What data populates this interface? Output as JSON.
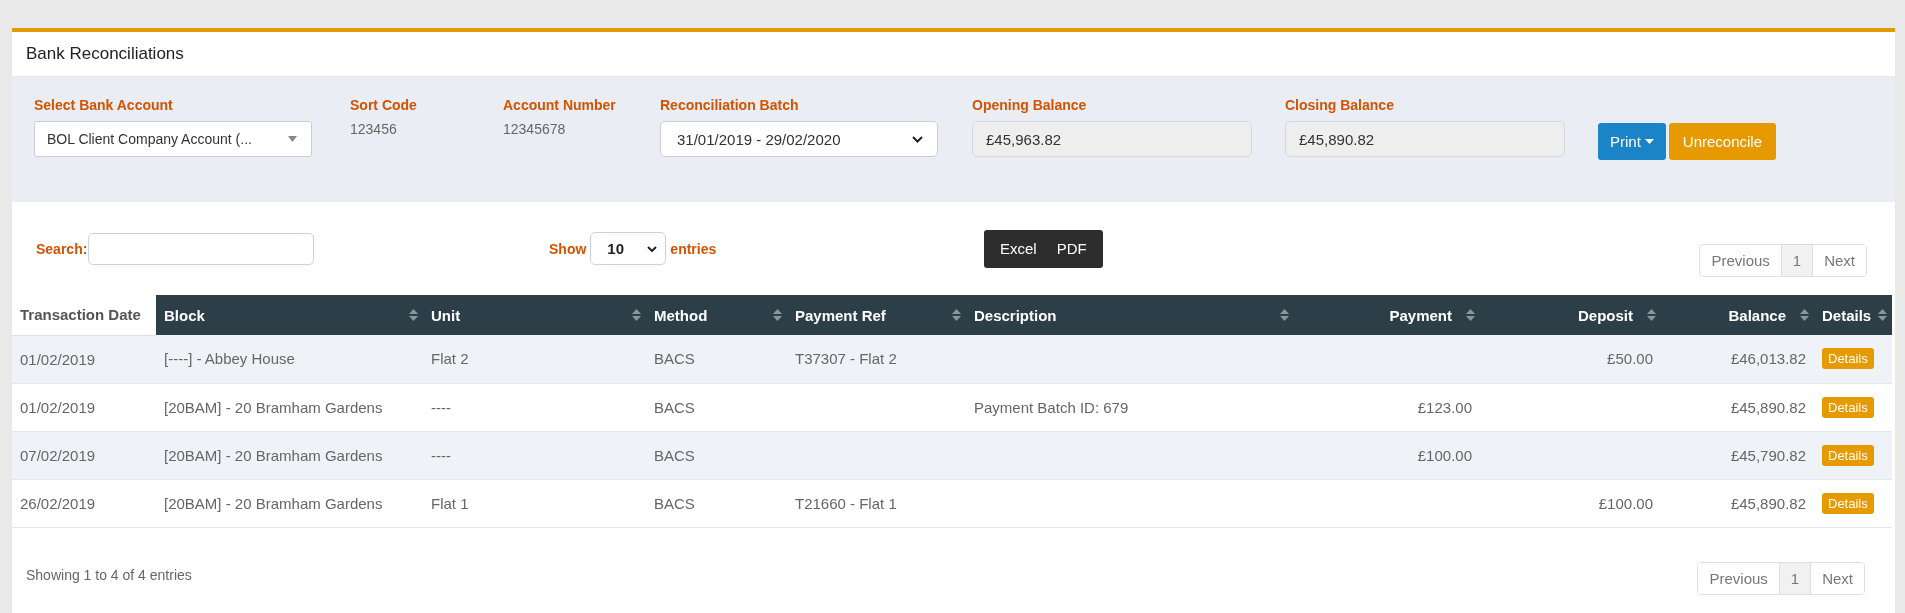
{
  "panel": {
    "title": "Bank Reconciliations"
  },
  "filters": {
    "bank_account": {
      "label": "Select Bank Account",
      "value": "BOL Client Company Account (..."
    },
    "sort_code": {
      "label": "Sort Code",
      "value": "123456"
    },
    "account_number": {
      "label": "Account Number",
      "value": "12345678"
    },
    "reconciliation_batch": {
      "label": "Reconciliation Batch",
      "value": "31/01/2019 - 29/02/2020"
    },
    "opening_balance": {
      "label": "Opening Balance",
      "value": "£45,963.82"
    },
    "closing_balance": {
      "label": "Closing Balance",
      "value": "£45,890.82"
    },
    "buttons": {
      "print": "Print",
      "unreconcile": "Unreconcile"
    }
  },
  "search": {
    "label": "Search:"
  },
  "page_length": {
    "show": "Show",
    "value": "10",
    "entries": "entries"
  },
  "export_buttons": [
    "Excel",
    "PDF"
  ],
  "pagination_top": [
    {
      "label": "Previous",
      "selected": false
    },
    {
      "label": "1",
      "selected": true
    },
    {
      "label": "Next",
      "selected": false
    }
  ],
  "table": {
    "columns": [
      {
        "label": "Transaction Date",
        "sortable": false
      },
      {
        "label": "Block",
        "sortable": true
      },
      {
        "label": "Unit",
        "sortable": true
      },
      {
        "label": "Method",
        "sortable": true
      },
      {
        "label": "Payment Ref",
        "sortable": true
      },
      {
        "label": "Description",
        "sortable": true
      },
      {
        "label": "Payment",
        "sortable": true
      },
      {
        "label": "Deposit",
        "sortable": true
      },
      {
        "label": "Balance",
        "sortable": true
      },
      {
        "label": "Details",
        "sortable": true
      }
    ],
    "rows": [
      {
        "cells": [
          "01/02/2019",
          "[----] - Abbey House",
          "Flat 2",
          "BACS",
          "T37307 - Flat 2",
          "",
          "",
          "£50.00",
          "£46,013.82"
        ],
        "details": "Details"
      },
      {
        "cells": [
          "01/02/2019",
          "[20BAM] - 20 Bramham Gardens",
          "----",
          "BACS",
          "",
          "Payment Batch ID: 679",
          "£123.00",
          "",
          "£45,890.82"
        ],
        "details": "Details"
      },
      {
        "cells": [
          "07/02/2019",
          "[20BAM] - 20 Bramham Gardens",
          "----",
          "BACS",
          "",
          "",
          "£100.00",
          "",
          "£45,790.82"
        ],
        "details": "Details"
      },
      {
        "cells": [
          "26/02/2019",
          "[20BAM] - 20 Bramham Gardens",
          "Flat 1",
          "BACS",
          "T21660 - Flat 1",
          "",
          "",
          "£100.00",
          "£45,890.82"
        ],
        "details": "Details"
      }
    ]
  },
  "info": "Showing 1 to 4 of 4 entries",
  "pagination_bottom": [
    {
      "label": "Previous",
      "selected": false
    },
    {
      "label": "1",
      "selected": true
    },
    {
      "label": "Next",
      "selected": false
    }
  ]
}
